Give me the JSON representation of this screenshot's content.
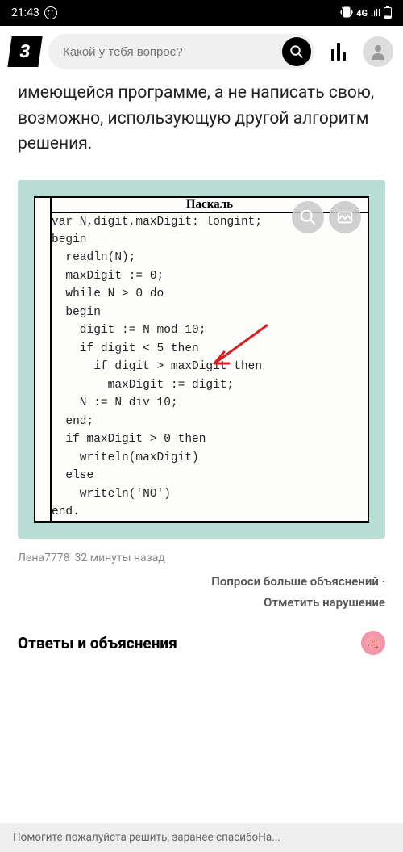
{
  "status_bar": {
    "time": "21:43",
    "network": "4G",
    "signal_label": ".ıll"
  },
  "header": {
    "logo_text": "3",
    "search_placeholder": "Какой у тебя вопрос?"
  },
  "question": {
    "text": "имеющейся программе, а не написать свою, возможно, использующую другой алгоритм решения."
  },
  "code": {
    "title": "Паскаль",
    "lines": "var N,digit,maxDigit: longint;\nbegin\n  readln(N);\n  maxDigit := 0;\n  while N > 0 do\n  begin\n    digit := N mod 10;\n    if digit < 5 then\n      if digit > maxDigit then\n        maxDigit := digit;\n    N := N div 10;\n  end;\n  if maxDigit > 0 then\n    writeln(maxDigit)\n  else\n    writeln('NO')\nend."
  },
  "meta": {
    "username": "Лена7778",
    "timestamp": "32 минуты назад"
  },
  "actions": {
    "ask_more": "Попроси больше объяснений  ·",
    "report": "Отметить нарушение"
  },
  "answers": {
    "title": "Ответы и объяснения",
    "brain_emoji": "🧠"
  },
  "ticker": {
    "text": "Помогите пожалуйста решить, заранее спасибоНа..."
  }
}
